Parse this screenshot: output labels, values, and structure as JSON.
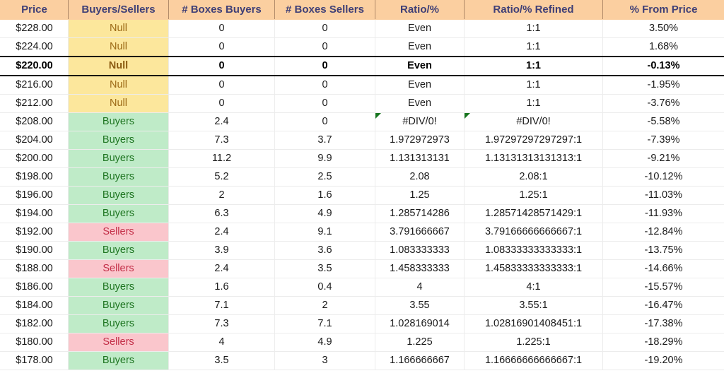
{
  "table": {
    "columns": [
      "Price",
      "Buyers/Sellers",
      "# Boxes Buyers",
      "# Boxes Sellers",
      "Ratio/%",
      "Ratio/% Refined",
      "% From Price"
    ],
    "colors": {
      "header_bg": "#FBCFA0",
      "header_text": "#3F3F76",
      "null_bg": "#FCE79C",
      "null_text": "#9C6A16",
      "buyers_bg": "#BFEBC8",
      "buyers_text": "#1E7521",
      "sellers_bg": "#FAC6CC",
      "sellers_text": "#C32F48",
      "error_flag": "#17761F",
      "highlight_border": "#000000"
    },
    "rows": [
      {
        "price": "$228.00",
        "category": "Null",
        "boxes_buyers": "0",
        "boxes_sellers": "0",
        "ratio": "Even",
        "ratio_refined": "1:1",
        "pct_from_price": "3.50%",
        "highlight": false,
        "error": false
      },
      {
        "price": "$224.00",
        "category": "Null",
        "boxes_buyers": "0",
        "boxes_sellers": "0",
        "ratio": "Even",
        "ratio_refined": "1:1",
        "pct_from_price": "1.68%",
        "highlight": false,
        "error": false
      },
      {
        "price": "$220.00",
        "category": "Null",
        "boxes_buyers": "0",
        "boxes_sellers": "0",
        "ratio": "Even",
        "ratio_refined": "1:1",
        "pct_from_price": "-0.13%",
        "highlight": true,
        "error": false
      },
      {
        "price": "$216.00",
        "category": "Null",
        "boxes_buyers": "0",
        "boxes_sellers": "0",
        "ratio": "Even",
        "ratio_refined": "1:1",
        "pct_from_price": "-1.95%",
        "highlight": false,
        "error": false
      },
      {
        "price": "$212.00",
        "category": "Null",
        "boxes_buyers": "0",
        "boxes_sellers": "0",
        "ratio": "Even",
        "ratio_refined": "1:1",
        "pct_from_price": "-3.76%",
        "highlight": false,
        "error": false
      },
      {
        "price": "$208.00",
        "category": "Buyers",
        "boxes_buyers": "2.4",
        "boxes_sellers": "0",
        "ratio": "#DIV/0!",
        "ratio_refined": "#DIV/0!",
        "pct_from_price": "-5.58%",
        "highlight": false,
        "error": true
      },
      {
        "price": "$204.00",
        "category": "Buyers",
        "boxes_buyers": "7.3",
        "boxes_sellers": "3.7",
        "ratio": "1.972972973",
        "ratio_refined": "1.97297297297297:1",
        "pct_from_price": "-7.39%",
        "highlight": false,
        "error": false
      },
      {
        "price": "$200.00",
        "category": "Buyers",
        "boxes_buyers": "11.2",
        "boxes_sellers": "9.9",
        "ratio": "1.131313131",
        "ratio_refined": "1.13131313131313:1",
        "pct_from_price": "-9.21%",
        "highlight": false,
        "error": false
      },
      {
        "price": "$198.00",
        "category": "Buyers",
        "boxes_buyers": "5.2",
        "boxes_sellers": "2.5",
        "ratio": "2.08",
        "ratio_refined": "2.08:1",
        "pct_from_price": "-10.12%",
        "highlight": false,
        "error": false
      },
      {
        "price": "$196.00",
        "category": "Buyers",
        "boxes_buyers": "2",
        "boxes_sellers": "1.6",
        "ratio": "1.25",
        "ratio_refined": "1.25:1",
        "pct_from_price": "-11.03%",
        "highlight": false,
        "error": false
      },
      {
        "price": "$194.00",
        "category": "Buyers",
        "boxes_buyers": "6.3",
        "boxes_sellers": "4.9",
        "ratio": "1.285714286",
        "ratio_refined": "1.28571428571429:1",
        "pct_from_price": "-11.93%",
        "highlight": false,
        "error": false
      },
      {
        "price": "$192.00",
        "category": "Sellers",
        "boxes_buyers": "2.4",
        "boxes_sellers": "9.1",
        "ratio": "3.791666667",
        "ratio_refined": "3.79166666666667:1",
        "pct_from_price": "-12.84%",
        "highlight": false,
        "error": false
      },
      {
        "price": "$190.00",
        "category": "Buyers",
        "boxes_buyers": "3.9",
        "boxes_sellers": "3.6",
        "ratio": "1.083333333",
        "ratio_refined": "1.08333333333333:1",
        "pct_from_price": "-13.75%",
        "highlight": false,
        "error": false
      },
      {
        "price": "$188.00",
        "category": "Sellers",
        "boxes_buyers": "2.4",
        "boxes_sellers": "3.5",
        "ratio": "1.458333333",
        "ratio_refined": "1.45833333333333:1",
        "pct_from_price": "-14.66%",
        "highlight": false,
        "error": false
      },
      {
        "price": "$186.00",
        "category": "Buyers",
        "boxes_buyers": "1.6",
        "boxes_sellers": "0.4",
        "ratio": "4",
        "ratio_refined": "4:1",
        "pct_from_price": "-15.57%",
        "highlight": false,
        "error": false
      },
      {
        "price": "$184.00",
        "category": "Buyers",
        "boxes_buyers": "7.1",
        "boxes_sellers": "2",
        "ratio": "3.55",
        "ratio_refined": "3.55:1",
        "pct_from_price": "-16.47%",
        "highlight": false,
        "error": false
      },
      {
        "price": "$182.00",
        "category": "Buyers",
        "boxes_buyers": "7.3",
        "boxes_sellers": "7.1",
        "ratio": "1.028169014",
        "ratio_refined": "1.02816901408451:1",
        "pct_from_price": "-17.38%",
        "highlight": false,
        "error": false
      },
      {
        "price": "$180.00",
        "category": "Sellers",
        "boxes_buyers": "4",
        "boxes_sellers": "4.9",
        "ratio": "1.225",
        "ratio_refined": "1.225:1",
        "pct_from_price": "-18.29%",
        "highlight": false,
        "error": false
      },
      {
        "price": "$178.00",
        "category": "Buyers",
        "boxes_buyers": "3.5",
        "boxes_sellers": "3",
        "ratio": "1.166666667",
        "ratio_refined": "1.16666666666667:1",
        "pct_from_price": "-19.20%",
        "highlight": false,
        "error": false
      }
    ]
  }
}
